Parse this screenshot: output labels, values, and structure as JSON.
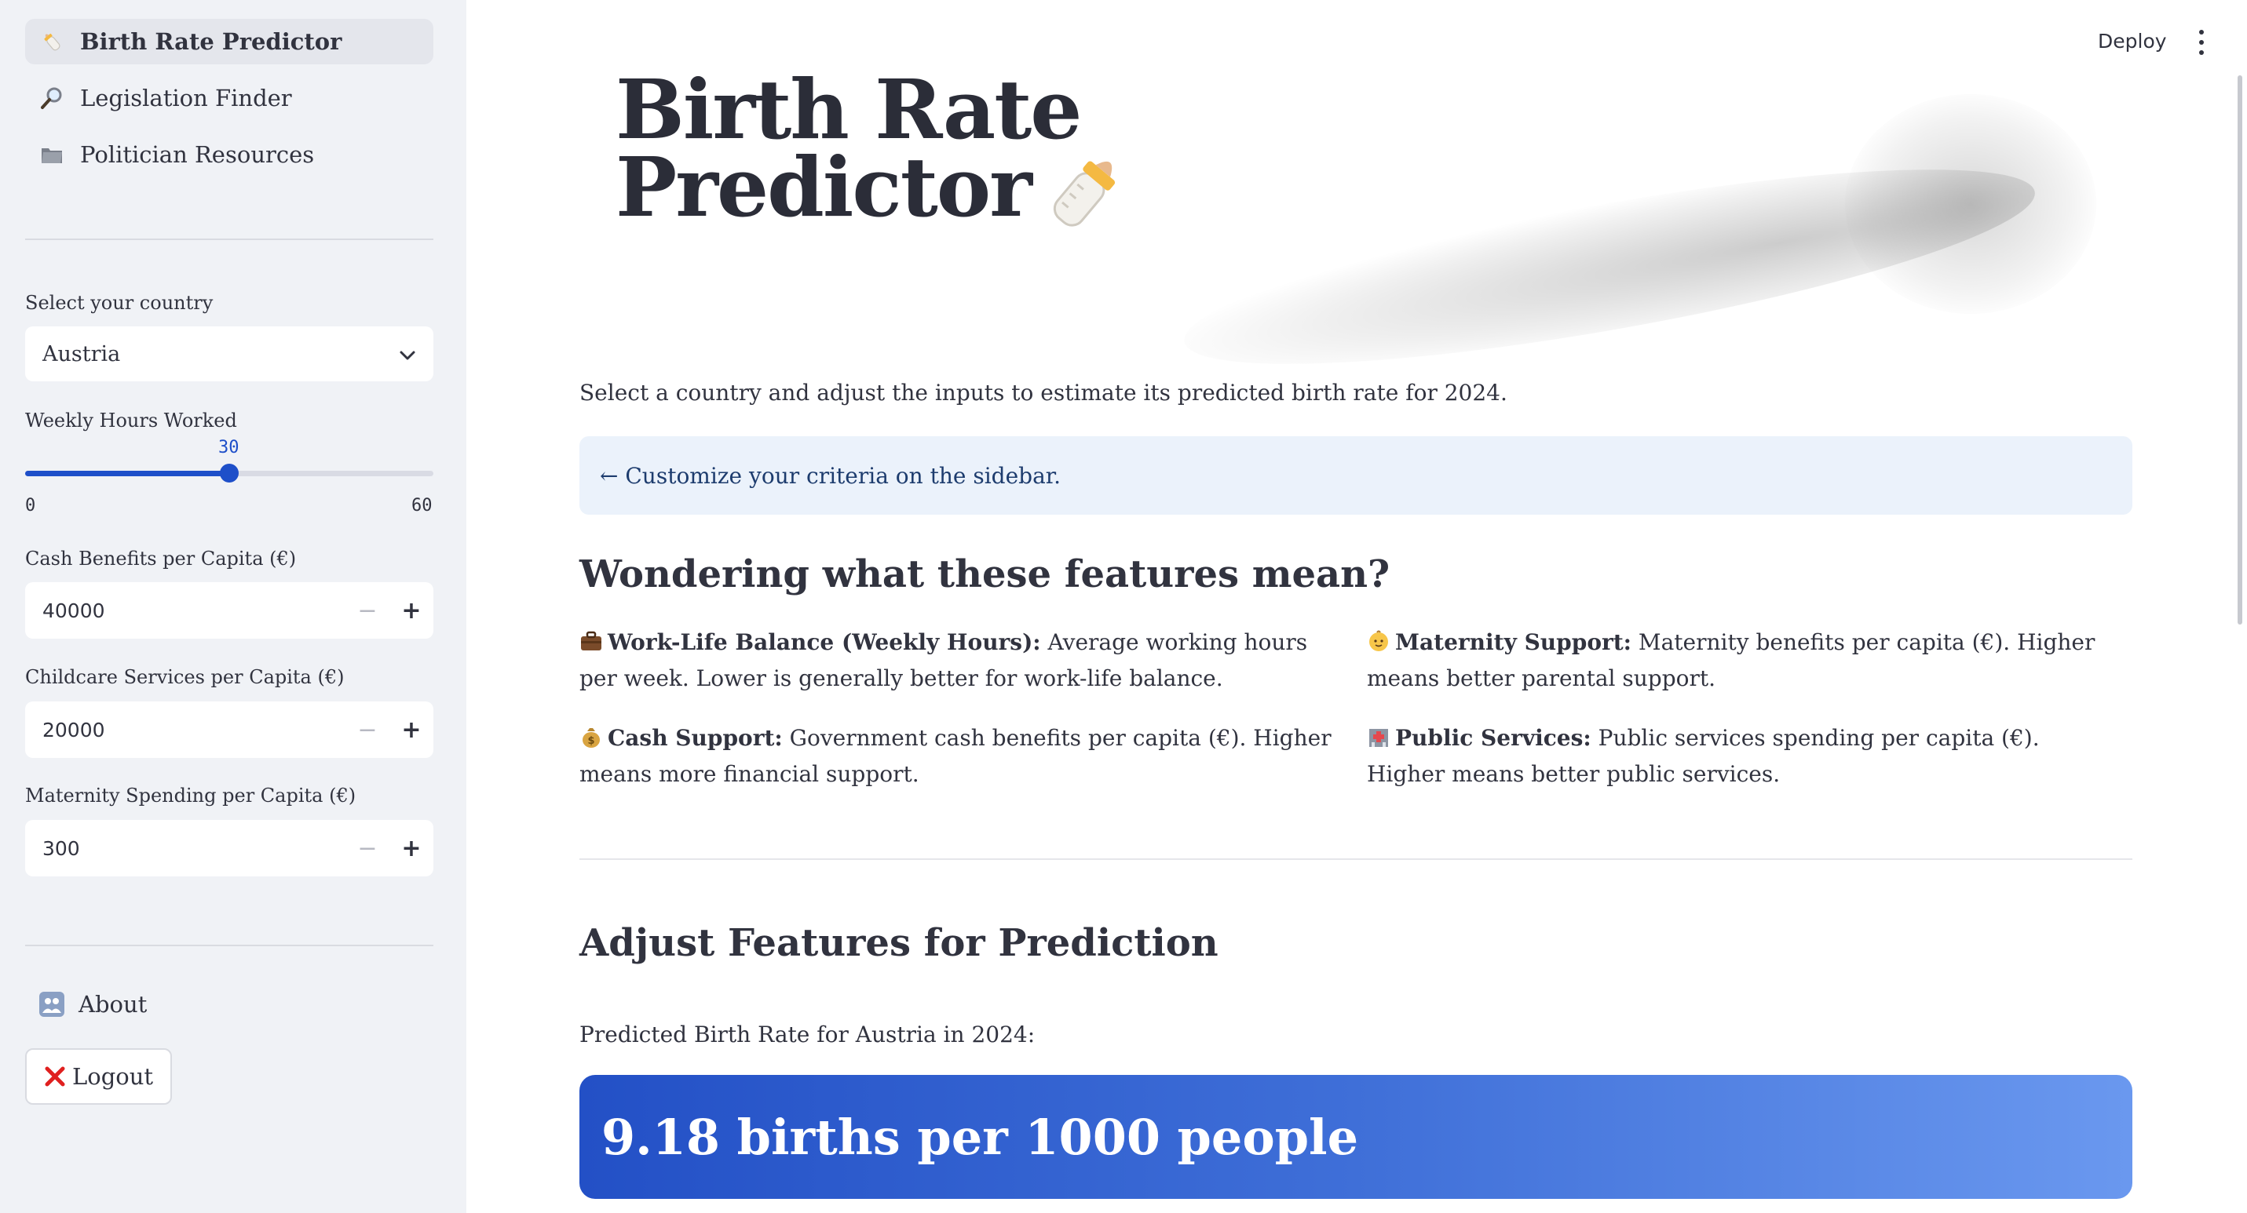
{
  "sidebar": {
    "nav": [
      {
        "label": "Birth Rate Predictor",
        "icon": "baby-bottle-icon",
        "active": true
      },
      {
        "label": "Legislation Finder",
        "icon": "magnifier-icon",
        "active": false
      },
      {
        "label": "Politician Resources",
        "icon": "folder-icon",
        "active": false
      }
    ],
    "country": {
      "label": "Select your country",
      "value": "Austria"
    },
    "hours": {
      "label": "Weekly Hours Worked",
      "value": 30,
      "min": 0,
      "max": 60,
      "value_text": "30",
      "min_text": "0",
      "max_text": "60"
    },
    "cash": {
      "label": "Cash Benefits per Capita (€)",
      "value": "40000"
    },
    "childcare": {
      "label": "Childcare Services per Capita (€)",
      "value": "20000"
    },
    "maternity": {
      "label": "Maternity Spending per Capita (€)",
      "value": "300"
    },
    "about_label": "About",
    "logout_label": "Logout",
    "minus": "−",
    "plus": "+"
  },
  "header": {
    "deploy_label": "Deploy"
  },
  "main": {
    "title_line1": "Birth Rate",
    "title_line2": "Predictor",
    "intro": "Select a country and adjust the inputs to estimate its predicted birth rate for 2024.",
    "info": "← Customize your criteria on the sidebar.",
    "features_heading": "Wondering what these features mean?",
    "features": [
      {
        "icon": "briefcase-icon",
        "title": "Work-Life Balance (Weekly Hours):",
        "text": " Average working hours per week. Lower is generally better for work-life balance."
      },
      {
        "icon": "baby-face-icon",
        "title": "Maternity Support:",
        "text": " Maternity benefits per capita (€). Higher means better parental support."
      },
      {
        "icon": "money-bag-icon",
        "title": "Cash Support:",
        "text": " Government cash benefits per capita (€). Higher means more financial support."
      },
      {
        "icon": "hospital-icon",
        "title": "Public Services:",
        "text": " Public services spending per capita (€). Higher means better public services."
      }
    ],
    "adjust_heading": "Adjust Features for Prediction",
    "prediction_label": "Predicted Birth Rate for Austria in 2024:",
    "prediction_value": "9.18 births per 1000 people"
  },
  "colors": {
    "accent": "#1e4fc9",
    "sidebar_bg": "#f0f2f6",
    "info_bg": "#ebf2fb",
    "gradient_start": "#2350c6",
    "gradient_end": "#6a98ef"
  }
}
